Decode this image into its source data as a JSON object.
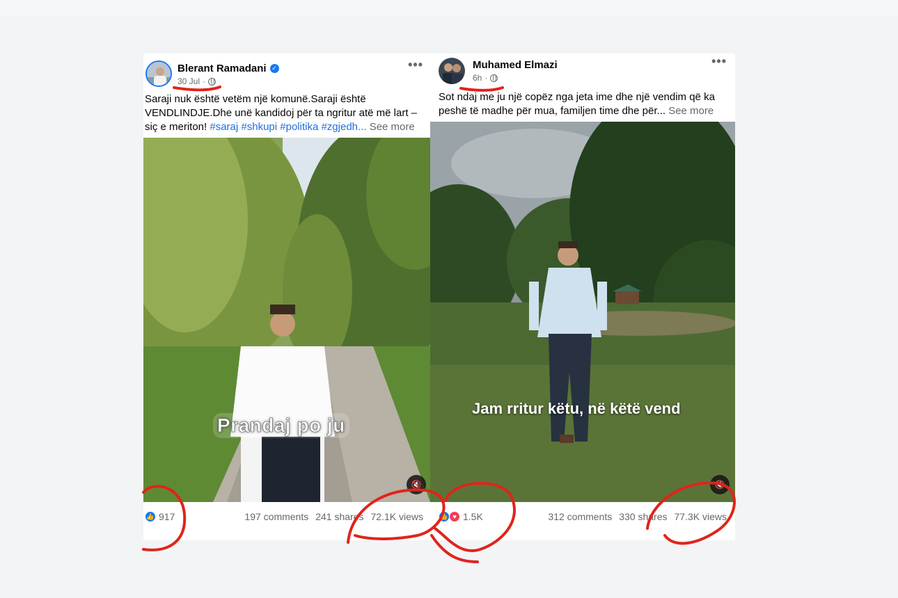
{
  "posts": [
    {
      "author": "Blerant Ramadani",
      "verified": true,
      "date": "30 Jul",
      "caption_main": "Saraji nuk është vetëm një komunë.Saraji është VENDLINDJE.Dhe unë kandidoj për ta ngritur atë më lart – siç e meriton! ",
      "hashtags": "#saraj #shkupi #politika  #zgjedh...",
      "see_more": "See more",
      "video_subtitle": "Prandaj po ju",
      "reaction_count": "917",
      "comments": "197 comments",
      "shares": "241 shares",
      "views": "72.1K views"
    },
    {
      "author": "Muhamed Elmazi",
      "verified": false,
      "date": "6h",
      "caption_main": "Sot ndaj me ju një copëz nga jeta ime dhe një vendim që ka peshë të madhe për mua, familjen time dhe për... ",
      "see_more": "See more",
      "video_subtitle": "Jam rritur këtu, në këtë vend",
      "reaction_count": "1.5K",
      "comments": "312 comments",
      "shares": "330 shares",
      "views": "77.3K views"
    }
  ],
  "icons": {
    "more": "more-options-icon",
    "globe": "globe-icon",
    "verified": "verified-badge-icon",
    "mute": "muted-speaker-icon",
    "like": "like-reaction-icon",
    "love": "love-reaction-icon"
  },
  "colors": {
    "accent": "#1877f2",
    "annotation": "#e0241b",
    "hashtag": "#216fdb"
  }
}
